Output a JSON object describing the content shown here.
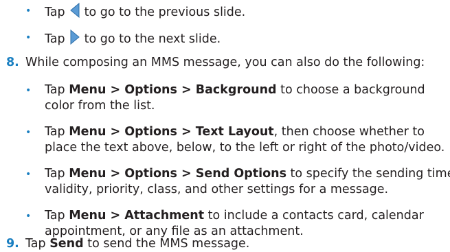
{
  "bullet_char": "•",
  "colors": {
    "accent": "#1a7fc1",
    "text": "#231f20",
    "arrow_fill": "#5b9bd5"
  },
  "icons": [
    "previous-slide-icon",
    "next-slide-icon"
  ],
  "items": {
    "prev": {
      "pre": "Tap",
      "post": "to go to the previous slide."
    },
    "next": {
      "pre": "Tap",
      "post": "to go to the next slide."
    },
    "step8": {
      "number": "8.",
      "text": "While composing an MMS message, you can also do the following:"
    },
    "bg": {
      "tap": "Tap ",
      "path": "Menu > Options > Background",
      "line1_rest": " to choose a background",
      "line2": "color from the list."
    },
    "layout": {
      "tap": "Tap ",
      "path": "Menu > Options > Text Layout",
      "line1_rest": ", then choose whether to",
      "line2": "place the text above, below, to the left or right of the photo/video."
    },
    "send_opts": {
      "tap": "Tap ",
      "path": "Menu > Options > Send Options",
      "line1_rest": " to specify the sending time,",
      "line2": "validity, priority, class, and other settings for a message."
    },
    "attach": {
      "tap": "Tap ",
      "path": "Menu > Attachment",
      "line1_rest": " to include a contacts card, calendar",
      "line2": "appointment, or any file as an attachment."
    },
    "step9": {
      "number": "9.",
      "tap": "Tap ",
      "bold": "Send",
      "rest": " to send the MMS message."
    }
  }
}
